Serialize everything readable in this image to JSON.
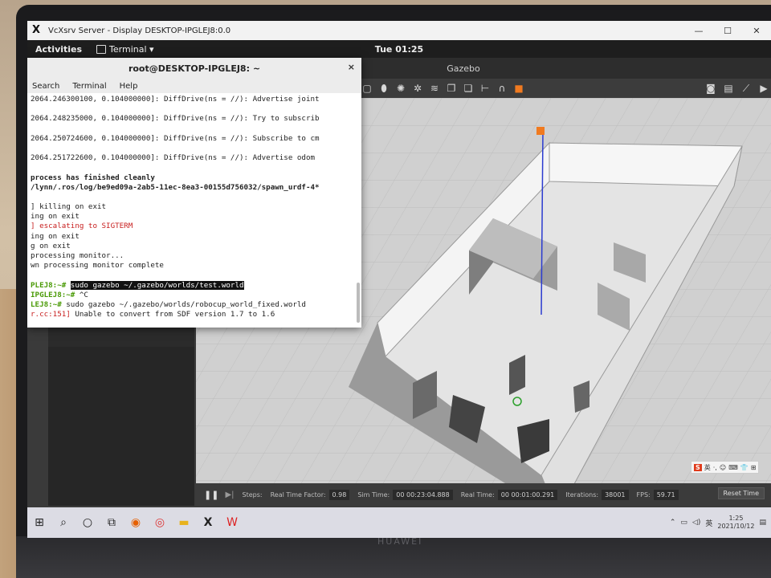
{
  "xserver": {
    "title": "VcXsrv Server - Display DESKTOP-IPGLEJ8:0.0",
    "icon": "x-logo-icon",
    "controls": {
      "minimize": "—",
      "maximize": "☐",
      "close": "✕"
    }
  },
  "gnome": {
    "activities": "Activities",
    "app_menu": "Terminal ▾",
    "clock": "Tue 01:25"
  },
  "terminal": {
    "title": "root@DESKTOP-IPGLEJ8: ~",
    "close": "×",
    "menu": [
      "Search",
      "Terminal",
      "Help"
    ],
    "lines": [
      {
        "text": "2064.246300100, 0.104000000]: DiffDrive(ns = //): Advertise joint",
        "style": ""
      },
      {
        "text": "",
        "style": ""
      },
      {
        "text": "2064.248235000, 0.104000000]: DiffDrive(ns = //): Try to subscrib",
        "style": ""
      },
      {
        "text": "",
        "style": ""
      },
      {
        "text": "2064.250724600, 0.104000000]: DiffDrive(ns = //): Subscribe to cm",
        "style": ""
      },
      {
        "text": "",
        "style": ""
      },
      {
        "text": "2064.251722600, 0.104000000]: DiffDrive(ns = //): Advertise odom",
        "style": ""
      },
      {
        "text": "",
        "style": ""
      },
      {
        "text": "process has finished cleanly",
        "style": "bold"
      },
      {
        "text": "/lynn/.ros/log/be9ed09a-2ab5-11ec-8ea3-00155d756032/spawn_urdf-4*",
        "style": "bold"
      },
      {
        "text": "",
        "style": ""
      },
      {
        "text": "] killing on exit",
        "style": "mixed-red-prefix"
      },
      {
        "text": "ing on exit",
        "style": ""
      },
      {
        "text": "] escalating to SIGTERM",
        "style": "red"
      },
      {
        "text": "ing on exit",
        "style": ""
      },
      {
        "text": "g on exit",
        "style": ""
      },
      {
        "text": "processing monitor...",
        "style": ""
      },
      {
        "text": "wn processing monitor complete",
        "style": ""
      },
      {
        "text": "",
        "style": ""
      },
      {
        "text": "PLEJ8:~# ",
        "style": "prompt",
        "cmd": "sudo gazebo ~/.gazebo/worlds/test.world",
        "cmd_style": "highlight"
      },
      {
        "text": "IPGLEJ8:~# ",
        "style": "prompt",
        "cmd": "^C",
        "cmd_style": ""
      },
      {
        "text": "LEJ8:~# ",
        "style": "prompt",
        "cmd": "sudo gazebo ~/.gazebo/worlds/robocup_world_fixed.world",
        "cmd_style": ""
      },
      {
        "text": "r.cc:151] ",
        "style": "red-prefix",
        "cmd": "Unable to convert from SDF version 1.7 to 1.6",
        "cmd_style": ""
      }
    ]
  },
  "gazebo": {
    "title": "Gazebo",
    "toolbar_icons": [
      "select-icon",
      "translate-icon",
      "rotate-icon",
      "scale-icon",
      "undo-icon",
      "redo-icon",
      "box-icon",
      "sphere-icon",
      "cylinder-icon",
      "pointlight-icon",
      "spotlight-icon",
      "dirlight-icon",
      "copy-icon",
      "paste-icon",
      "align-icon",
      "snap-icon",
      "orange-model-icon"
    ],
    "toolbar_right_icons": [
      "screenshot-icon",
      "log-icon",
      "plot-icon",
      "video-icon"
    ],
    "status": {
      "steps_label": "Steps:",
      "rtf_label": "Real Time Factor:",
      "rtf_value": "0.98",
      "sim_time_label": "Sim Time:",
      "sim_time_value": "00 00:23:04.888",
      "real_time_label": "Real Time:",
      "real_time_value": "00 00:01:00.291",
      "iterations_label": "Iterations:",
      "iterations_value": "38001",
      "fps_label": "FPS:",
      "fps_value": "59.71",
      "reset": "Reset Time"
    }
  },
  "ime": {
    "s": "S",
    "mode": "英",
    "items": [
      "·,",
      "☺",
      "⌨",
      "👕",
      "⊞"
    ]
  },
  "taskbar": {
    "icons": [
      "windows-start-icon",
      "search-icon",
      "cortana-icon",
      "task-view-icon",
      "firefox-icon",
      "chrome-like-icon",
      "file-explorer-icon",
      "vcxsrv-icon",
      "wps-icon"
    ],
    "tray_time": "1:25",
    "tray_date": "2021/10/12"
  },
  "device": {
    "brand": "HUAWEI"
  }
}
